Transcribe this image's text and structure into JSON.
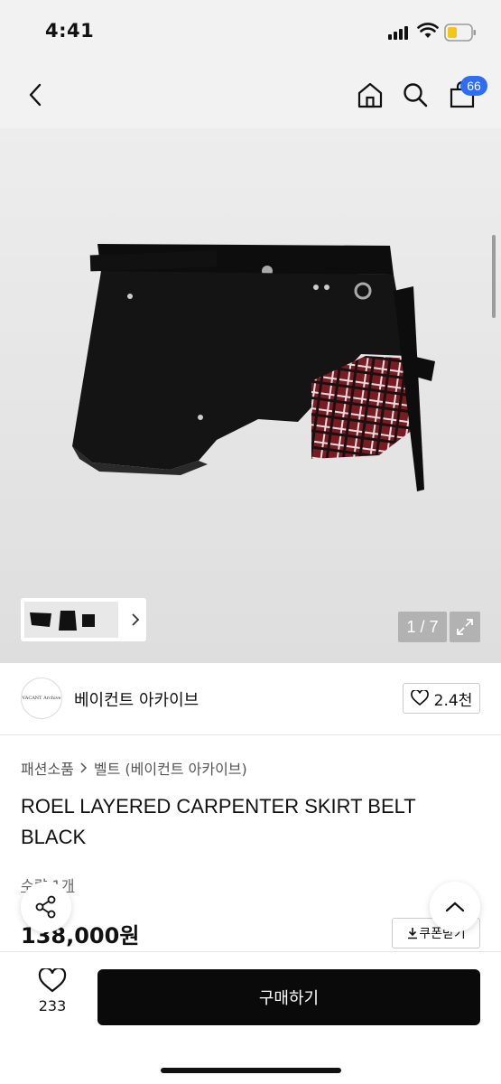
{
  "status": {
    "time": "4:41"
  },
  "nav": {
    "cart_count": "66"
  },
  "gallery": {
    "counter": "1 / 7"
  },
  "seller": {
    "logo_text": "VACANT Archive",
    "name": "베이컨트 아카이브",
    "likes": "2.4천"
  },
  "breadcrumb": {
    "category": "패션소품",
    "subcategory": "벨트 (베이컨트 아카이브)"
  },
  "product": {
    "title": "ROEL LAYERED CARPENTER SKIRT BELT BLACK",
    "stock": "수량 1개",
    "price": "138,000원",
    "coupon_label": "쿠폰받기"
  },
  "bottom": {
    "wish_count": "233",
    "buy_label": "구매하기"
  },
  "colors": {
    "accent_badge": "#2f6df6",
    "buy_button": "#0a0a0a"
  },
  "icons": [
    "back-icon",
    "home-icon",
    "search-icon",
    "shopping-bag-icon",
    "chevron-right-icon",
    "expand-icon",
    "heart-icon",
    "share-icon",
    "chevron-up-icon",
    "download-icon"
  ]
}
